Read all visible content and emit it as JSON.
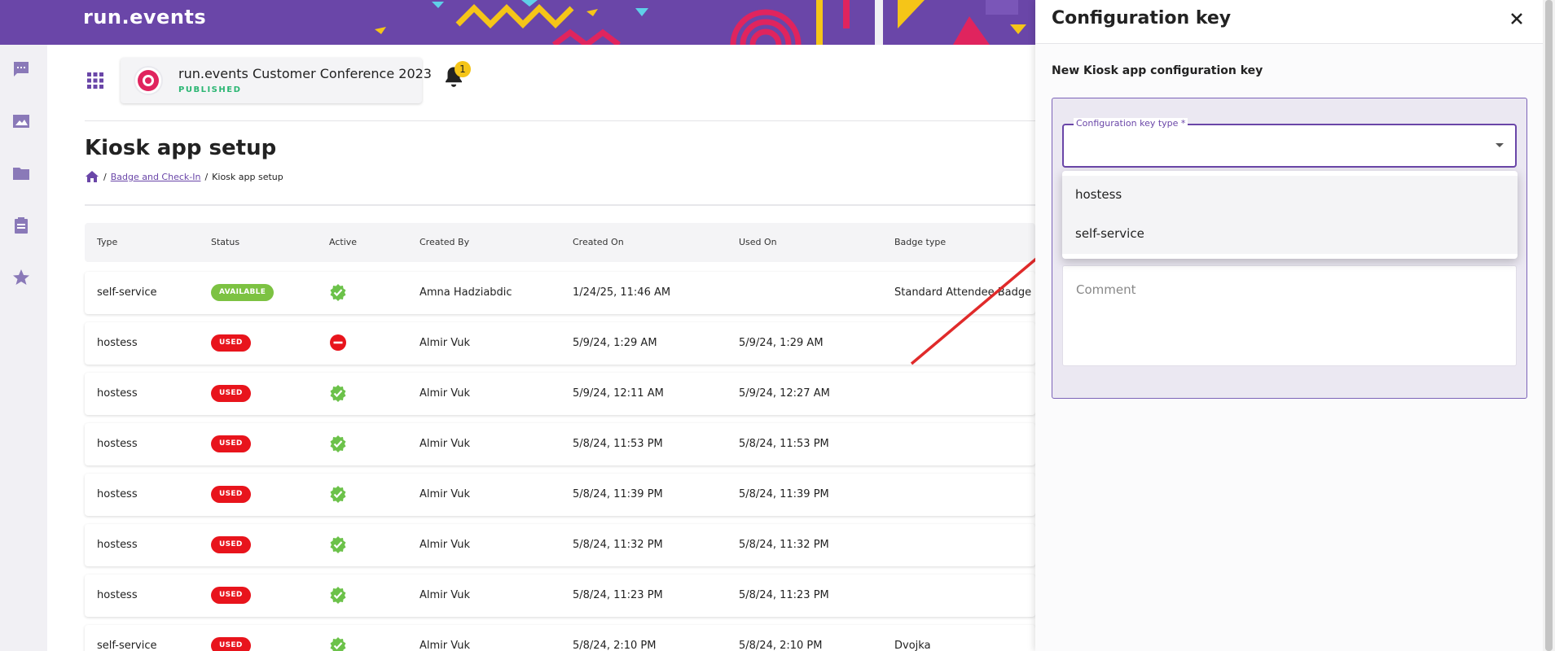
{
  "brand": {
    "name": "run.events"
  },
  "header": {
    "event_title": "run.events Customer Conference 2023",
    "event_status": "PUBLISHED",
    "notifications_count": "1"
  },
  "page": {
    "title": "Kiosk app setup",
    "breadcrumb": {
      "parent": "Badge and Check-In",
      "current": "Kiosk app setup"
    }
  },
  "table": {
    "columns": [
      "Type",
      "Status",
      "Active",
      "Created By",
      "Created On",
      "Used On",
      "Badge type"
    ],
    "rows": [
      {
        "type": "self-service",
        "status": "AVAILABLE",
        "active": "check",
        "created_by": "Amna Hadziabdic",
        "created_on": "1/24/25, 11:46 AM",
        "used_on": "",
        "badge_type": "Standard Attendee Badge"
      },
      {
        "type": "hostess",
        "status": "USED",
        "active": "minus",
        "created_by": "Almir Vuk",
        "created_on": "5/9/24, 1:29 AM",
        "used_on": "5/9/24, 1:29 AM",
        "badge_type": ""
      },
      {
        "type": "hostess",
        "status": "USED",
        "active": "check",
        "created_by": "Almir Vuk",
        "created_on": "5/9/24, 12:11 AM",
        "used_on": "5/9/24, 12:27 AM",
        "badge_type": ""
      },
      {
        "type": "hostess",
        "status": "USED",
        "active": "check",
        "created_by": "Almir Vuk",
        "created_on": "5/8/24, 11:53 PM",
        "used_on": "5/8/24, 11:53 PM",
        "badge_type": ""
      },
      {
        "type": "hostess",
        "status": "USED",
        "active": "check",
        "created_by": "Almir Vuk",
        "created_on": "5/8/24, 11:39 PM",
        "used_on": "5/8/24, 11:39 PM",
        "badge_type": ""
      },
      {
        "type": "hostess",
        "status": "USED",
        "active": "check",
        "created_by": "Almir Vuk",
        "created_on": "5/8/24, 11:32 PM",
        "used_on": "5/8/24, 11:32 PM",
        "badge_type": ""
      },
      {
        "type": "hostess",
        "status": "USED",
        "active": "check",
        "created_by": "Almir Vuk",
        "created_on": "5/8/24, 11:23 PM",
        "used_on": "5/8/24, 11:23 PM",
        "badge_type": ""
      },
      {
        "type": "self-service",
        "status": "USED",
        "active": "check",
        "created_by": "Almir Vuk",
        "created_on": "5/8/24, 2:10 PM",
        "used_on": "5/8/24, 2:10 PM",
        "badge_type": "Dvojka"
      }
    ]
  },
  "drawer": {
    "title": "Configuration key",
    "subtitle": "New Kiosk app configuration key",
    "key_type_label": "Configuration key type *",
    "options": [
      "hostess",
      "self-service"
    ],
    "comment_placeholder": "Comment"
  },
  "colors": {
    "brand_purple": "#6a46a8",
    "available_green": "#7cc242",
    "used_red": "#e8141c",
    "check_green": "#6cc24a",
    "published_green": "#2bb673",
    "annotation_red": "#e02a2a"
  }
}
